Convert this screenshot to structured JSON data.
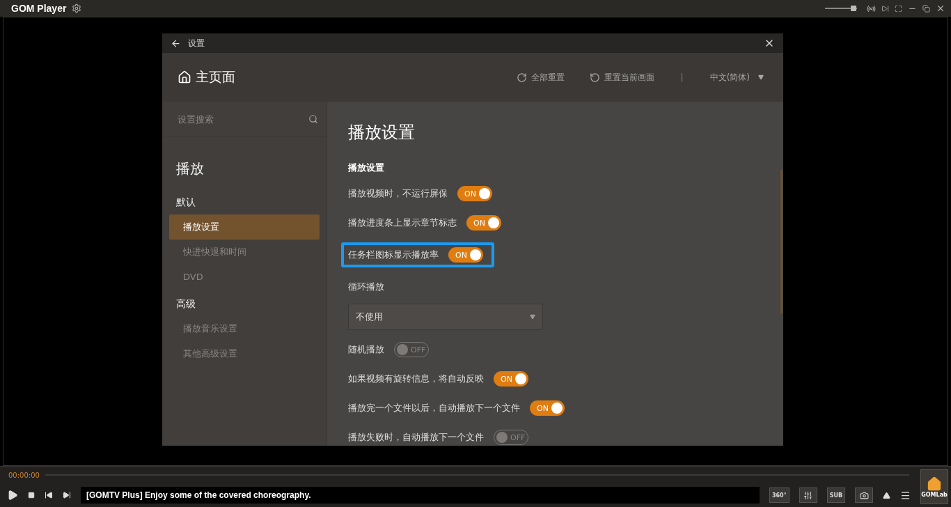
{
  "app": {
    "title": "GOM Player",
    "volume": {
      "level": 0.9
    }
  },
  "dialog": {
    "title": "设置",
    "home": "主页面",
    "actions": [
      {
        "label": "全部重置",
        "kind": "reset_all"
      },
      {
        "label": "重置当前画面",
        "kind": "reset_page"
      }
    ],
    "separator": "|",
    "language": "中文(简体)",
    "search": {
      "placeholder": "设置搜索"
    },
    "sidebar": [
      {
        "kind": "section",
        "label": "播放"
      },
      {
        "kind": "group",
        "label": "默认"
      },
      {
        "kind": "item",
        "label": "播放设置",
        "selected": true
      },
      {
        "kind": "item",
        "label": "快进快退和时间",
        "selected": false
      },
      {
        "kind": "item",
        "label": "DVD",
        "selected": false
      },
      {
        "kind": "group",
        "label": "高级"
      },
      {
        "kind": "item",
        "label": "播放音乐设置",
        "selected": false
      },
      {
        "kind": "item",
        "label": "其他高级设置",
        "selected": false
      }
    ],
    "page_title": "播放设置",
    "section_title": "播放设置",
    "rows": [
      {
        "kind": "toggle",
        "label": "播放视频时，不运行屏保",
        "on": true,
        "state": "ON",
        "highlighted": false
      },
      {
        "kind": "toggle",
        "label": "播放进度条上显示章节标志",
        "on": true,
        "state": "ON",
        "highlighted": false
      },
      {
        "kind": "toggle",
        "label": "任务栏图标显示播放率",
        "on": true,
        "state": "ON",
        "highlighted": true
      },
      {
        "kind": "dropdown",
        "label": "循环播放",
        "value": "不使用"
      },
      {
        "kind": "toggle",
        "label": "随机播放",
        "on": false,
        "state": "OFF",
        "highlighted": false
      },
      {
        "kind": "toggle",
        "label": "如果视频有旋转信息，将自动反映",
        "on": true,
        "state": "ON",
        "highlighted": false
      },
      {
        "kind": "toggle",
        "label": "播放完一个文件以后，自动播放下一个文件",
        "on": true,
        "state": "ON",
        "highlighted": false
      },
      {
        "kind": "toggle",
        "label": "播放失败时，自动播放下一个文件",
        "on": false,
        "state": "OFF",
        "highlighted": false
      }
    ]
  },
  "player": {
    "time": "00:00:00",
    "ticker": "[GOMTV Plus] Enjoy some of the covered choreography.",
    "badge_360": "360°",
    "subtitle": "SUB",
    "brand": "GOMLab"
  }
}
